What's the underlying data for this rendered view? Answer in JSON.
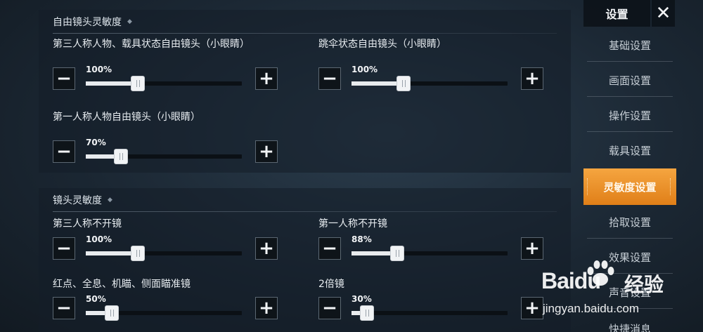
{
  "sections": [
    {
      "title": "自由镜头灵敏度",
      "settings": [
        {
          "label": "第三人称人物、载具状态自由镜头（小眼睛）",
          "value": "100%",
          "fraction": 0.335
        },
        {
          "label": "跳伞状态自由镜头（小眼睛）",
          "value": "100%",
          "fraction": 0.335
        },
        {
          "label": "第一人称人物自由镜头（小眼睛）",
          "value": "70%",
          "fraction": 0.225
        }
      ]
    },
    {
      "title": "镜头灵敏度",
      "settings": [
        {
          "label": "第三人称不开镜",
          "value": "100%",
          "fraction": 0.335
        },
        {
          "label": "第一人称不开镜",
          "value": "88%",
          "fraction": 0.295
        },
        {
          "label": "红点、全息、机瞄、侧面瞄准镜",
          "value": "50%",
          "fraction": 0.165
        },
        {
          "label": "2倍镜",
          "value": "30%",
          "fraction": 0.1
        }
      ]
    }
  ],
  "controls": {
    "minus": "−",
    "plus": "+"
  },
  "panel": {
    "title": "设置",
    "close": "✕",
    "nav": [
      "基础设置",
      "画面设置",
      "操作设置",
      "载具设置",
      "灵敏度设置",
      "拾取设置",
      "效果设置",
      "声音设置",
      "快捷消息"
    ],
    "active_index": 4
  },
  "watermark": {
    "logo": "Bai",
    "logo_du": "du",
    "text": "经验",
    "url": "jingyan.baidu.com"
  },
  "colors": {
    "accent": "#f5a540",
    "slider_fill": "#e8ebee"
  }
}
